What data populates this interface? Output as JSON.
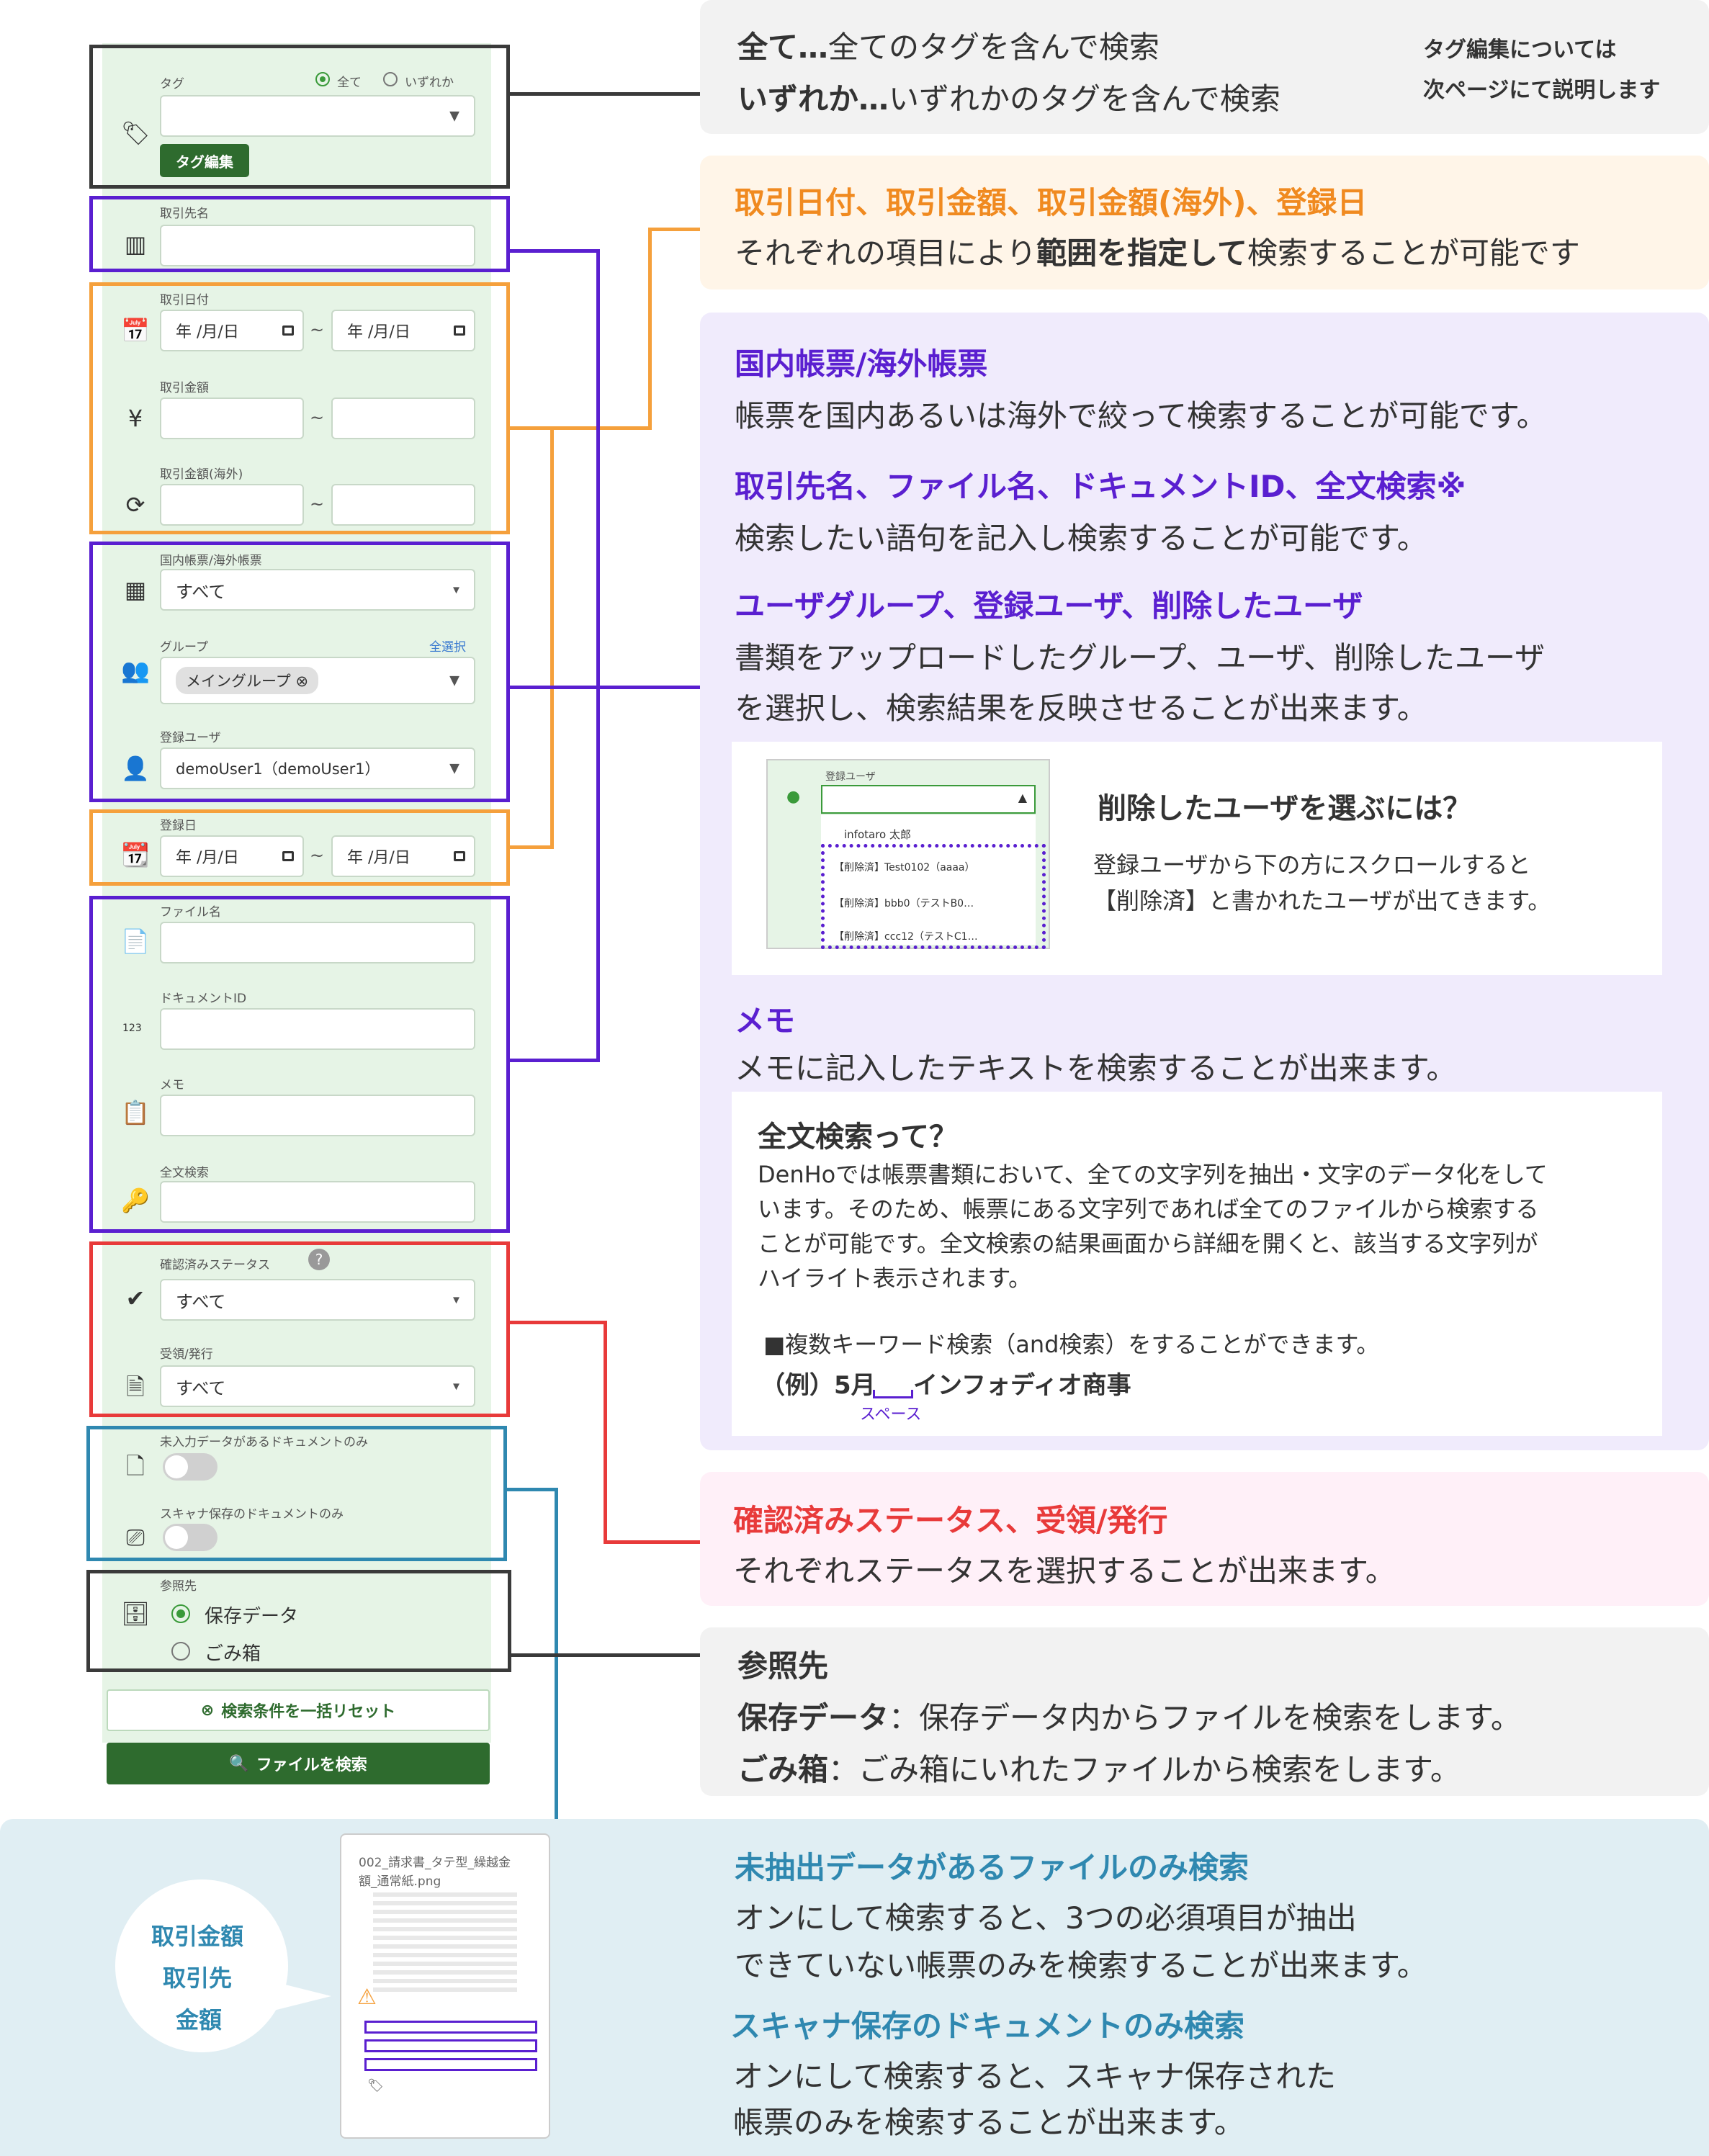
{
  "panel": {
    "tag": {
      "label": "タグ",
      "radio_all": "全て",
      "radio_any": "いずれか",
      "edit_button": "タグ編集"
    },
    "supplier": {
      "label": "取引先名"
    },
    "date": {
      "label": "取引日付",
      "from_placeholder": "年 /月/日",
      "to_placeholder": "年 /月/日"
    },
    "amount": {
      "label": "取引金額"
    },
    "amount_foreign": {
      "label": "取引金額(海外)"
    },
    "domestic": {
      "label": "国内帳票/海外帳票",
      "value": "すべて"
    },
    "group": {
      "label": "グループ",
      "select_all": "全選択",
      "chip": "メイングループ"
    },
    "user": {
      "label": "登録ユーザ",
      "value": "demoUser1（demoUser1）"
    },
    "regdate": {
      "label": "登録日",
      "from_placeholder": "年 /月/日",
      "to_placeholder": "年 /月/日"
    },
    "filename": {
      "label": "ファイル名"
    },
    "docid": {
      "label": "ドキュメントID",
      "icon_text": "123"
    },
    "memo": {
      "label": "メモ"
    },
    "fulltext": {
      "label": "全文検索"
    },
    "confirm": {
      "label": "確認済みステータス",
      "value": "すべて"
    },
    "receive": {
      "label": "受領/発行",
      "value": "すべて"
    },
    "unentered": {
      "label": "未入力データがあるドキュメントのみ"
    },
    "scanner": {
      "label": "スキャナ保存のドキュメントのみ"
    },
    "ref": {
      "label": "参照先",
      "opt_saved": "保存データ",
      "opt_trash": "ごみ箱"
    },
    "reset_button": "検索条件を一括リセット",
    "search_button": "ファイルを検索"
  },
  "info": {
    "tag": {
      "l1_b": "全て…",
      "l1": "全てのタグを含んで検索",
      "l2_b": "いずれか…",
      "l2": "いずれかのタグを含んで検索",
      "note1": "タグ編集については",
      "note2": "次ページにて説明します"
    },
    "range": {
      "head": "取引日付、取引金額、取引金額(海外)、登録日",
      "l1a": "それぞれの項目により",
      "l1b": "範囲を指定して",
      "l1c": "検索することが可能です"
    },
    "purple": {
      "h1": "国内帳票/海外帳票",
      "p1": "帳票を国内あるいは海外で絞って検索することが可能です。",
      "h2": "取引先名、ファイル名、ドキュメントID、全文検索※",
      "p2": "検索したい語句を記入し検索することが可能です。",
      "h3": "ユーザグループ、登録ユーザ、削除したユーザ",
      "p3a": "書類をアップロードしたグループ、ユーザ、削除したユーザ",
      "p3b": "を選択し、検索結果を反映させることが出来ます。",
      "h4": "メモ",
      "p4": "メモに記入したテキストを検索することが出来ます。"
    },
    "deleted": {
      "head": "削除したユーザを選ぶには？",
      "p1": "登録ユーザから下の方にスクロールすると",
      "p2": "【削除済】と書かれたユーザが出てきます。",
      "shot_label": "登録ユーザ",
      "shot_items": [
        "infotaro 太郎",
        "【削除済】Test0102（aaaa）",
        "【削除済】bbb0（テストB0…",
        "【削除済】ccc12（テストC1…"
      ]
    },
    "fulltext": {
      "head": "全文検索って？",
      "p1": "DenHoでは帳票書類において、全ての文字列を抽出・文字のデータ化をして",
      "p2": "います。そのため、帳票にある文字列であれば全てのファイルから検索する",
      "p3": "ことが可能です。全文検索の結果画面から詳細を開くと、該当する文字列が",
      "p4": "ハイライト表示されます。",
      "p5": "■複数キーワード検索（and検索）をすることができます。",
      "ex_a": "（例）5月",
      "ex_b": "インフォディオ商事",
      "space": "スペース"
    },
    "status": {
      "head": "確認済みステータス、受領/発行",
      "p1": "それぞれステータスを選択することが出来ます。"
    },
    "ref": {
      "head": "参照先",
      "l1b": "保存データ",
      "l1": "：保存データ内からファイルを検索をします。",
      "l2b": "ごみ箱",
      "l2": "：ごみ箱にいれたファイルから検索をします。"
    },
    "blue": {
      "h1": "未抽出データがあるファイルのみ検索",
      "p1a": "オンにして検索すると、3つの必須項目が抽出",
      "p1b": "できていない帳票のみを検索することが出来ます。",
      "h2": "スキャナ保存のドキュメントのみ検索",
      "p2a": "オンにして検索すると、スキャナ保存された",
      "p2b": "帳票のみを検索することが出来ます。",
      "bubble": [
        "取引金額",
        "取引先",
        "金額"
      ],
      "card_title1": "002_請求書_タテ型_繰越金",
      "card_title2": "額_通常紙.png"
    }
  },
  "colors": {
    "black": "#3a3a3a",
    "orange": "#f5a03c",
    "purple": "#5a1fd0",
    "red": "#e83a3a",
    "blue": "#2f88b0",
    "green": "#2e6b2e"
  }
}
